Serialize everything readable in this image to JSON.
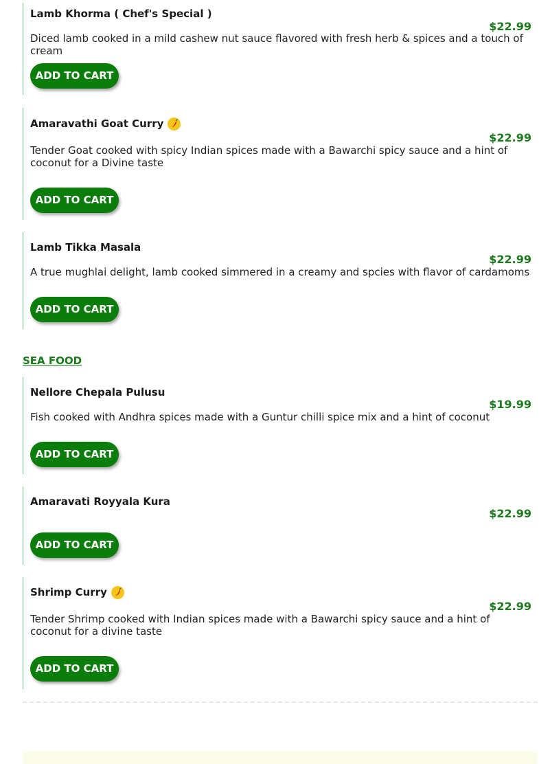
{
  "items": [
    {
      "name": "Lamb Khorma ( Chef's Special )",
      "spicy": false,
      "price": "$22.99",
      "description": "Diced lamb cooked in a mild cashew nut sauce flavored with fresh herb & spices and a touch of cream",
      "button": "ADD TO CART"
    },
    {
      "name": "Amaravathi Goat Curry",
      "spicy": true,
      "price": "$22.99",
      "description": "Tender Goat cooked with spicy Indian spices made with a Bawarchi spicy sauce and a hint of coconut for a Divine taste",
      "button": "ADD TO CART"
    },
    {
      "name": "Lamb Tikka Masala",
      "spicy": false,
      "price": "$22.99",
      "description": "A true mughlai delight, lamb cooked simmered in a creamy and spcies with flavor of cardamoms",
      "button": "ADD TO CART"
    }
  ],
  "sections": [
    {
      "title": "SEA FOOD",
      "items": [
        {
          "name": "Nellore Chepala Pulusu",
          "spicy": false,
          "price": "$19.99",
          "description": "Fish cooked with Andhra spices made with a Guntur chilli spice mix and a hint of coconut",
          "button": "ADD TO CART"
        },
        {
          "name": "Amaravati Royyala Kura",
          "spicy": false,
          "price": "$22.99",
          "description": "",
          "button": "ADD TO CART"
        },
        {
          "name": "Shrimp Curry",
          "spicy": true,
          "price": "$22.99",
          "description": "Tender Shrimp cooked with Indian spices made with a Bawarchi spicy sauce and a hint of coconut for a divine taste",
          "button": "ADD TO CART"
        }
      ]
    }
  ],
  "icons": {
    "spicy": "chili-pepper-icon"
  },
  "colors": {
    "accent_green": "#0a7d0a",
    "price_green": "#1b7a1b",
    "spicy_badge": "#f5c518"
  }
}
